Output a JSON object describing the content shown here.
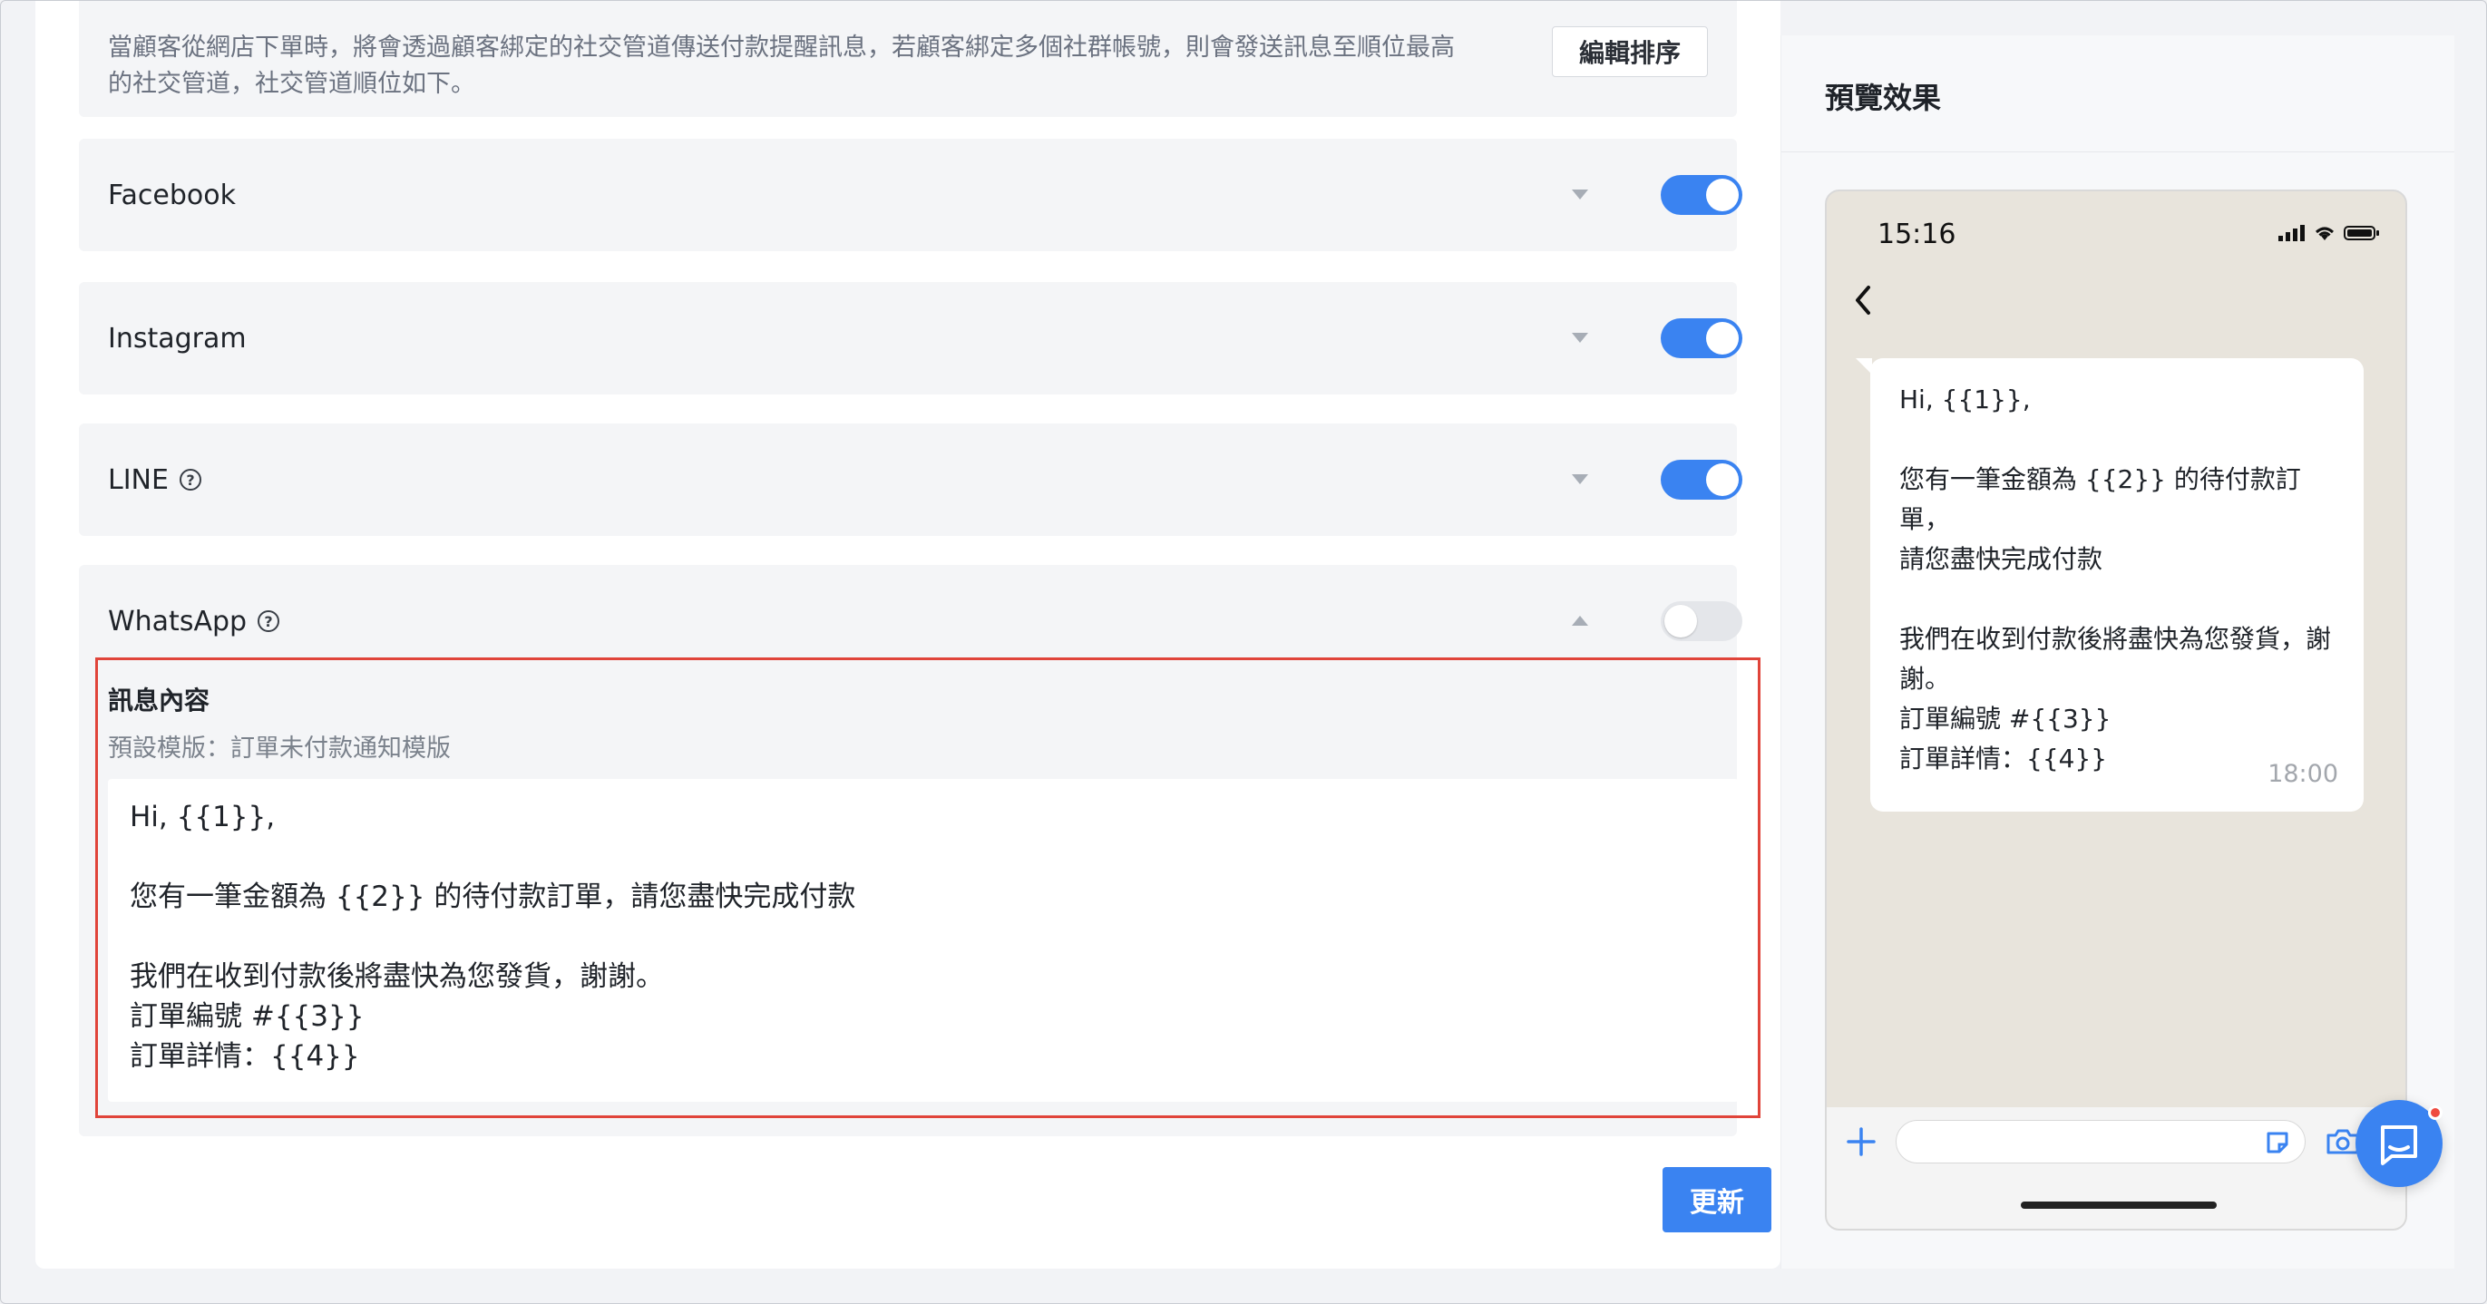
{
  "info": {
    "description_line1": "當顧客從網店下單時，將會透過顧客綁定的社交管道傳送付款提醒訊息，若顧客綁定多個社群帳號，則會發送訊息至順位最高",
    "description_line2": "的社交管道，社交管道順位如下。",
    "edit_order_label": "編輯排序"
  },
  "channels": [
    {
      "name": "Facebook",
      "enabled": true,
      "has_help": false,
      "expanded": false
    },
    {
      "name": "Instagram",
      "enabled": true,
      "has_help": false,
      "expanded": false
    },
    {
      "name": "LINE",
      "enabled": true,
      "has_help": true,
      "expanded": false
    },
    {
      "name": "WhatsApp",
      "enabled": false,
      "has_help": true,
      "expanded": true
    }
  ],
  "whatsapp_message": {
    "title": "訊息內容",
    "template_label": "預設模版：訂單未付款通知模版",
    "lines": [
      "Hi, {{1}},",
      "",
      "您有一筆金額為 {{2}} 的待付款訂單，請您盡快完成付款",
      "",
      "我們在收到付款後將盡快為您發貨，謝謝。",
      "訂單編號 #{{3}}",
      "訂單詳情：{{4}}"
    ]
  },
  "update_label": "更新",
  "preview": {
    "title": "預覽效果",
    "phone_time": "15:16",
    "bubble_lines": [
      "Hi, {{1}},",
      "",
      "您有一筆金額為 {{2}} 的待付款訂單，",
      "請您盡快完成付款",
      "",
      "我們在收到付款後將盡快為您發貨，謝",
      "謝。",
      "訂單編號 #{{3}}",
      "訂單詳情：{{4}}"
    ],
    "bubble_time": "18:00"
  },
  "icons": {
    "help": "help-circle-icon",
    "back": "chevron-left-icon",
    "plus": "plus-icon",
    "sticker": "sticker-icon",
    "camera": "camera-icon",
    "chat": "chat-bubble-icon"
  },
  "colors": {
    "accent": "#3a83f1",
    "highlight_border": "#e0443a",
    "notification_dot": "#ef4a3f"
  }
}
